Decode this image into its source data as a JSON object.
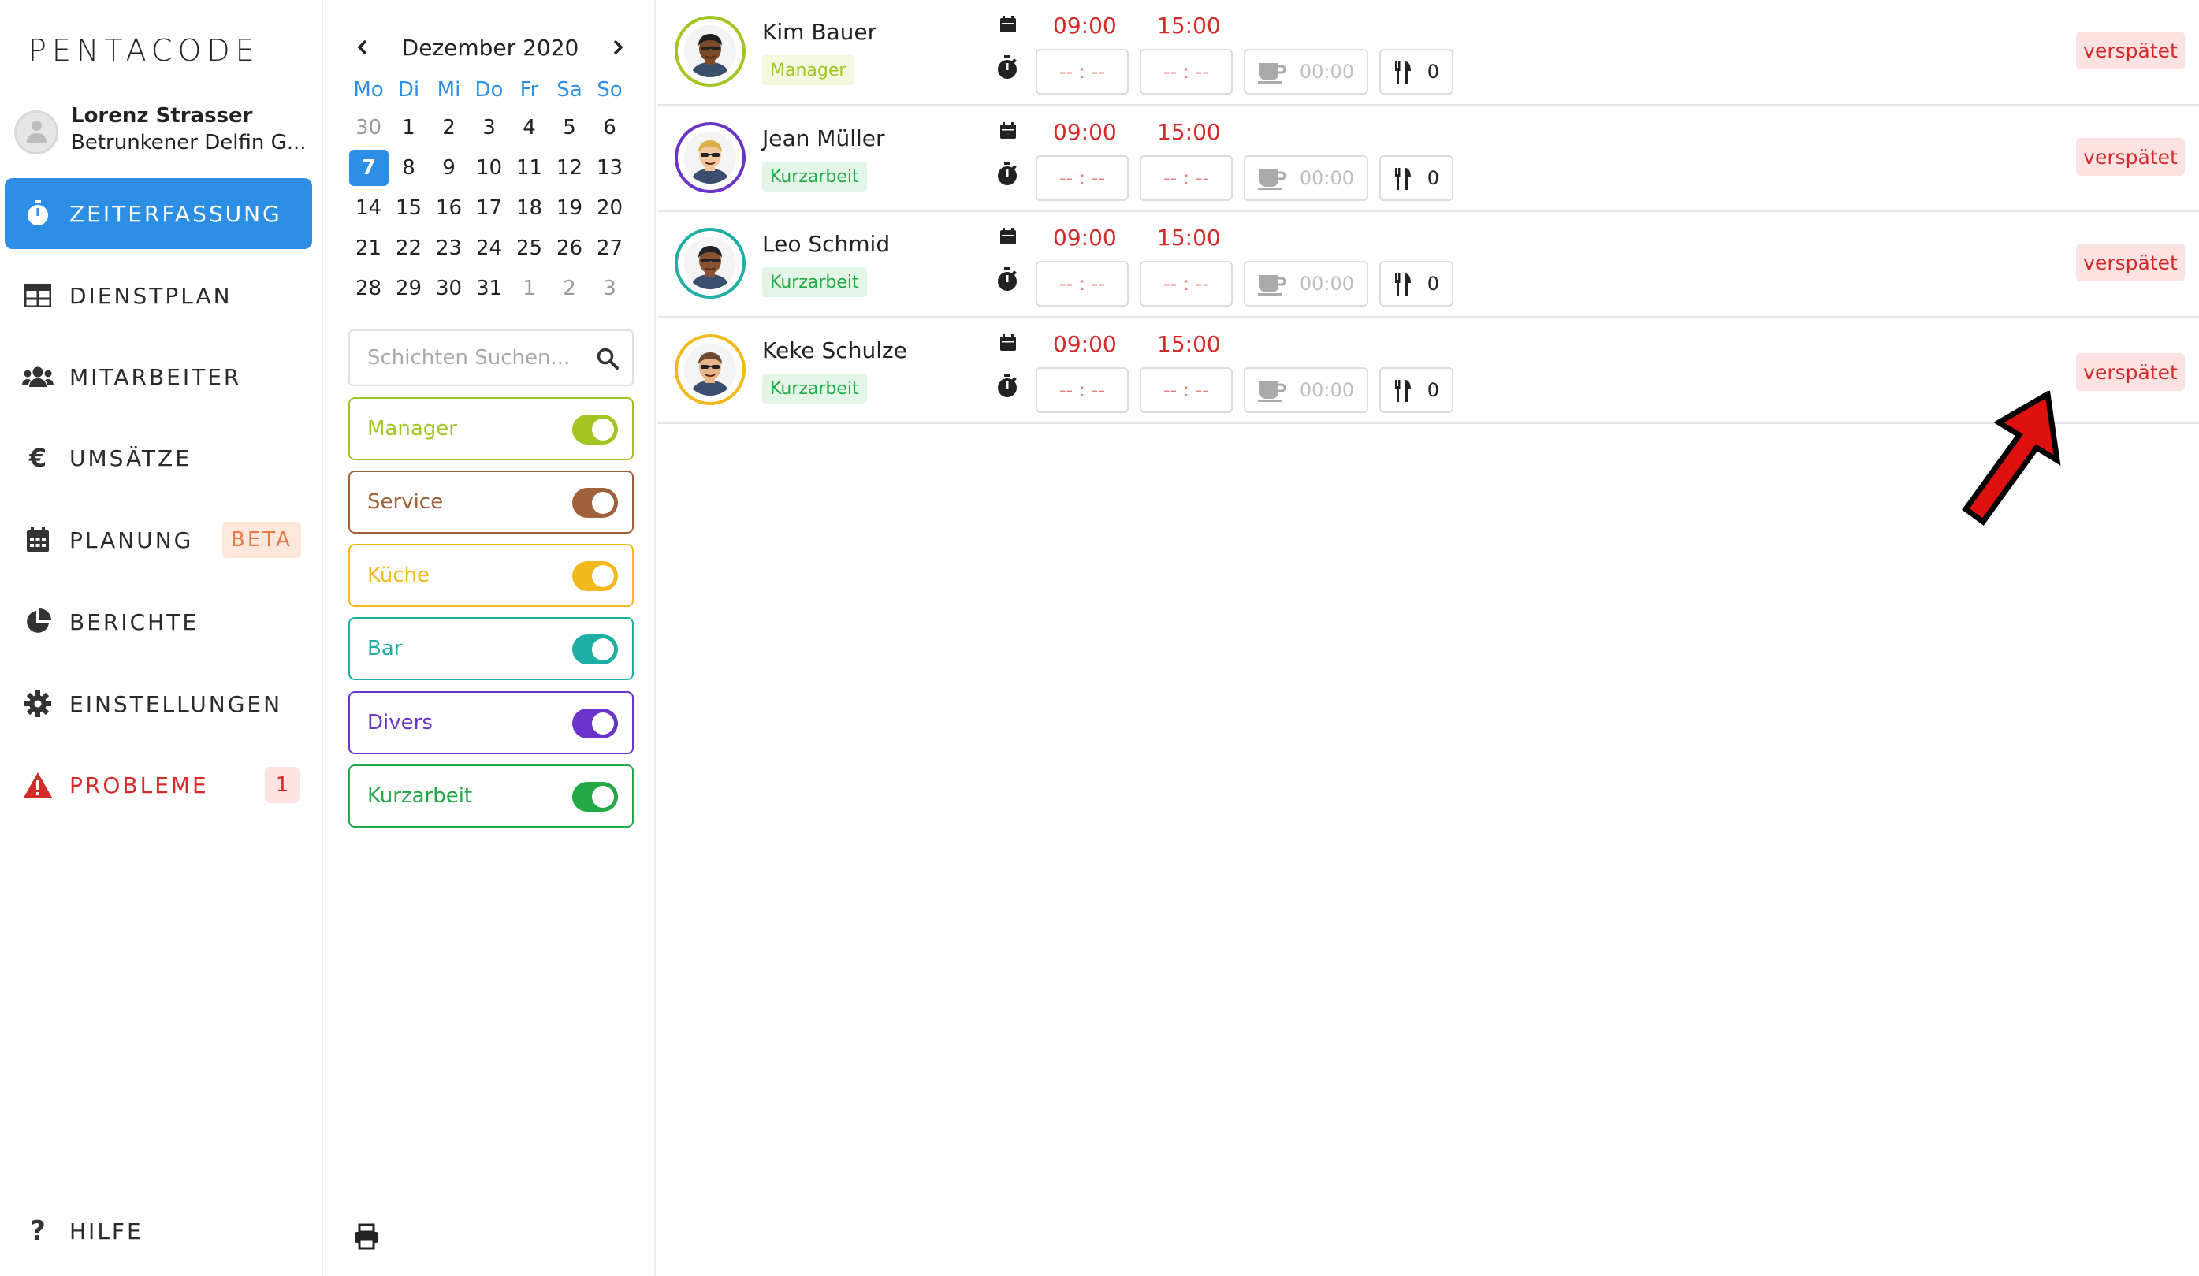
{
  "app": {
    "logo": "PENTACODE",
    "user_name": "Lorenz Strasser",
    "company": "Betrunkener Delfin G..."
  },
  "nav": {
    "items": [
      {
        "label": "ZEITERFASSUNG",
        "icon": "stopwatch-icon",
        "active": true
      },
      {
        "label": "DIENSTPLAN",
        "icon": "table-icon"
      },
      {
        "label": "MITARBEITER",
        "icon": "users-icon"
      },
      {
        "label": "UMSÄTZE",
        "icon": "euro-icon"
      },
      {
        "label": "PLANUNG",
        "icon": "calendar-icon",
        "badge": "BETA"
      },
      {
        "label": "BERICHTE",
        "icon": "pie-chart-icon"
      },
      {
        "label": "EINSTELLUNGEN",
        "icon": "gear-icon"
      },
      {
        "label": "PROBLEME",
        "icon": "warning-icon",
        "badge": "1"
      }
    ],
    "help": "HILFE"
  },
  "calendar": {
    "month_label": "Dezember 2020",
    "weekdays": [
      "Mo",
      "Di",
      "Mi",
      "Do",
      "Fr",
      "Sa",
      "So"
    ],
    "days": [
      "30",
      "1",
      "2",
      "3",
      "4",
      "5",
      "6",
      "7",
      "8",
      "9",
      "10",
      "11",
      "12",
      "13",
      "14",
      "15",
      "16",
      "17",
      "18",
      "19",
      "20",
      "21",
      "22",
      "23",
      "24",
      "25",
      "26",
      "27",
      "28",
      "29",
      "30",
      "31",
      "1",
      "2",
      "3"
    ],
    "muted_indices": [
      0,
      32,
      33,
      34
    ],
    "selected_index": 7,
    "accent": "#2d8ee5"
  },
  "search": {
    "placeholder": "Schichten Suchen..."
  },
  "filters": [
    {
      "label": "Manager",
      "color": "#a3c522",
      "enabled": true
    },
    {
      "label": "Service",
      "color": "#a0603a",
      "enabled": true
    },
    {
      "label": "Küche",
      "color": "#f2b81c",
      "enabled": true
    },
    {
      "label": "Bar",
      "color": "#1eaea3",
      "enabled": true
    },
    {
      "label": "Divers",
      "color": "#6a34c8",
      "enabled": true
    },
    {
      "label": "Kurzarbeit",
      "color": "#22a845",
      "enabled": true
    }
  ],
  "employees": [
    {
      "name": "Kim Bauer",
      "tag": "Manager",
      "tag_color": "#a3c522",
      "tag_bg": "#f3f8df",
      "ring": "#a3c522",
      "start": "09:00",
      "end": "15:00",
      "in_start": "-- : --",
      "in_end": "-- : --",
      "pause": "00:00",
      "meals": "0",
      "status": "verspätet",
      "skin": "#7a4a2a",
      "hair": "#1f1f1f"
    },
    {
      "name": "Jean Müller",
      "tag": "Kurzarbeit",
      "tag_color": "#22a845",
      "tag_bg": "#e2f5e6",
      "ring": "#6a34c8",
      "start": "09:00",
      "end": "15:00",
      "in_start": "-- : --",
      "in_end": "-- : --",
      "pause": "00:00",
      "meals": "0",
      "status": "verspätet",
      "skin": "#f1c79b",
      "hair": "#d9b14a"
    },
    {
      "name": "Leo Schmid",
      "tag": "Kurzarbeit",
      "tag_color": "#22a845",
      "tag_bg": "#e2f5e6",
      "ring": "#1eaea3",
      "start": "09:00",
      "end": "15:00",
      "in_start": "-- : --",
      "in_end": "-- : --",
      "pause": "00:00",
      "meals": "0",
      "status": "verspätet",
      "skin": "#8a5232",
      "hair": "#222222"
    },
    {
      "name": "Keke Schulze",
      "tag": "Kurzarbeit",
      "tag_color": "#22a845",
      "tag_bg": "#e2f5e6",
      "ring": "#f2b81c",
      "start": "09:00",
      "end": "15:00",
      "in_start": "-- : --",
      "in_end": "-- : --",
      "pause": "00:00",
      "meals": "0",
      "status": "verspätet",
      "skin": "#e8b48a",
      "hair": "#6b4a35"
    }
  ],
  "colors": {
    "late_text": "#d42a2a",
    "late_bg": "#fde2e2",
    "annotation_arrow": "#e01010"
  }
}
